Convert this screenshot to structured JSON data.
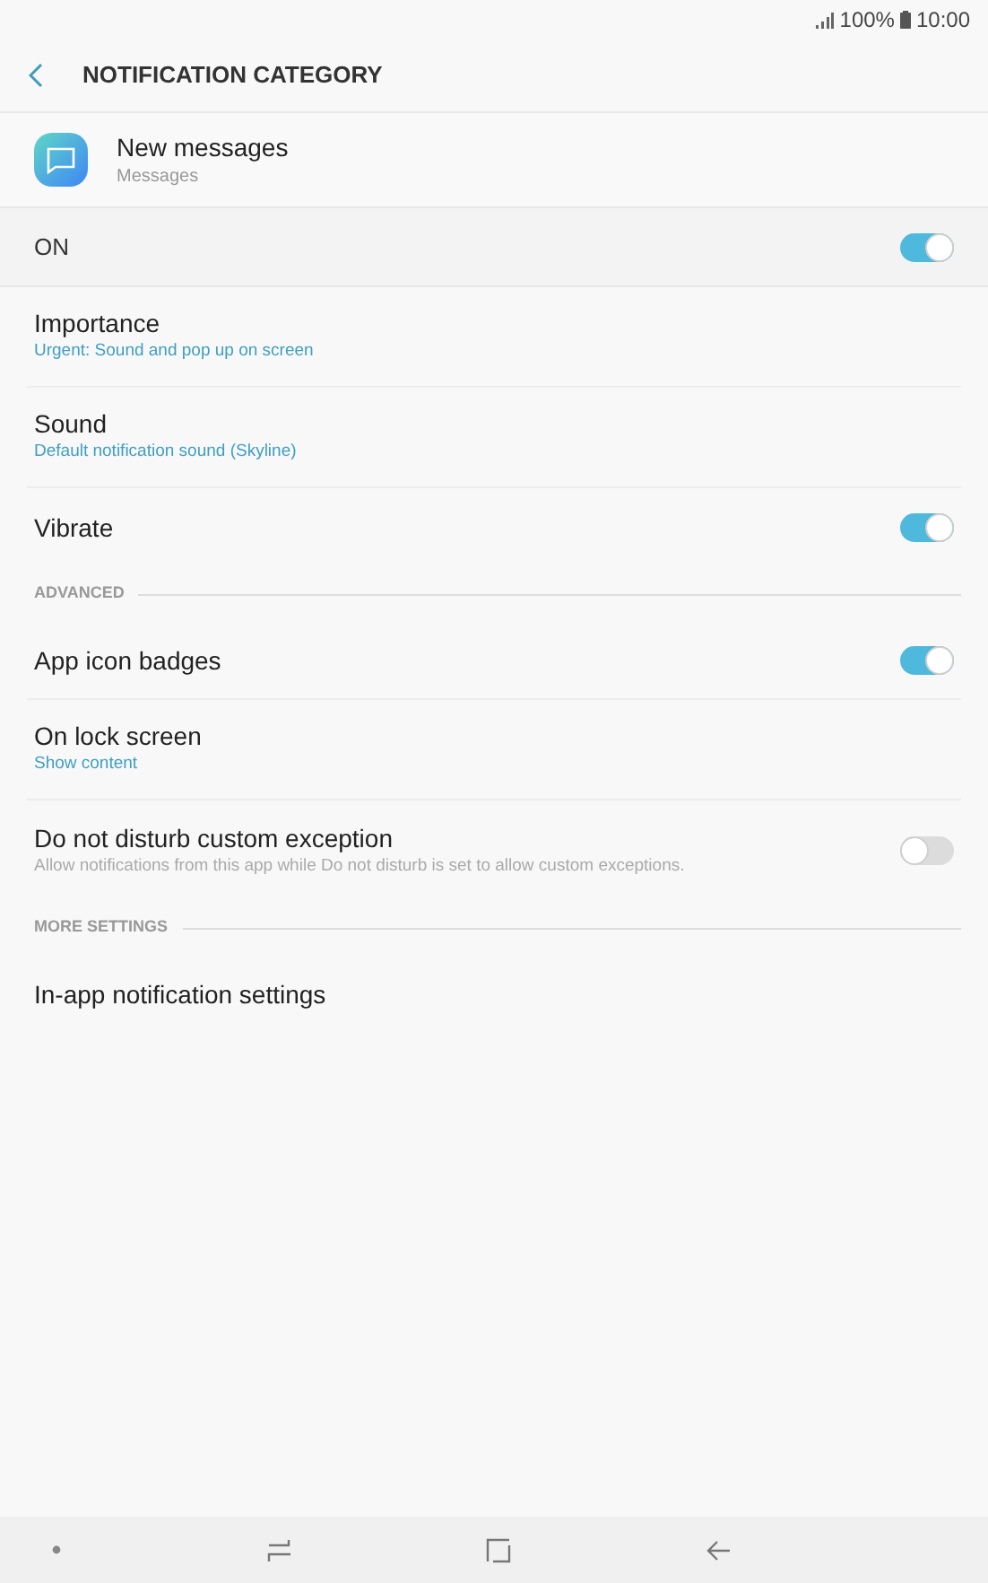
{
  "status_bar": {
    "battery": "100%",
    "time": "10:00"
  },
  "header": {
    "title": "NOTIFICATION CATEGORY"
  },
  "category": {
    "name": "New messages",
    "app": "Messages"
  },
  "master": {
    "label": "ON",
    "on": true
  },
  "items": [
    {
      "kind": "row",
      "title": "Importance",
      "subtitle": "Urgent: Sound and pop up on screen",
      "subtitle_accent": true
    },
    {
      "kind": "row",
      "title": "Sound",
      "subtitle": "Default notification sound (Skyline)",
      "subtitle_accent": true
    },
    {
      "kind": "toggle",
      "title": "Vibrate",
      "on": true
    },
    {
      "kind": "section",
      "title": "ADVANCED"
    },
    {
      "kind": "toggle",
      "title": "App icon badges",
      "on": true
    },
    {
      "kind": "row",
      "title": "On lock screen",
      "subtitle": "Show content",
      "subtitle_accent": true
    },
    {
      "kind": "toggle",
      "title": "Do not disturb custom exception",
      "subtitle": "Allow notifications from this app while Do not disturb is set to allow custom exceptions.",
      "on": false
    },
    {
      "kind": "section",
      "title": "MORE SETTINGS"
    },
    {
      "kind": "row",
      "title": "In-app notification settings"
    }
  ]
}
